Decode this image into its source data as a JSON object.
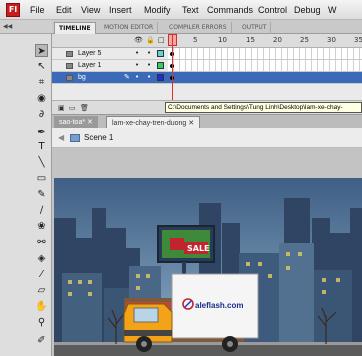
{
  "app": {
    "logo_text": "Fl"
  },
  "menu": [
    "File",
    "Edit",
    "View",
    "Insert",
    "Modify",
    "Text",
    "Commands",
    "Control",
    "Debug",
    "W"
  ],
  "panel_tabs": [
    "TIMELINE",
    "MOTION EDITOR",
    "COMPILER ERRORS",
    "OUTPUT"
  ],
  "timeline": {
    "frame_numbers": [
      "1",
      "5",
      "10",
      "15",
      "20",
      "25",
      "30",
      "35"
    ],
    "current_frame": 1,
    "layers": [
      {
        "name": "Layer 5",
        "color": "#5fd3d3",
        "selected": false
      },
      {
        "name": "Layer 1",
        "color": "#33cc66",
        "selected": false
      },
      {
        "name": "bg",
        "color": "#1a2fd8",
        "selected": true
      }
    ],
    "path_tooltip": "C:\\Documents and Settings\\Tung Linh\\Desktop\\lam-xe-chay-"
  },
  "document_tabs": [
    {
      "label": "sao-toa*",
      "active": false
    },
    {
      "label": "lam-xe-chay-tren-duong",
      "active": true
    }
  ],
  "editbar": {
    "scene": "Scene 1"
  },
  "stage": {
    "billboard_text": "SALE",
    "truck_sign_text": "aleflash.com"
  },
  "colors": {
    "sky_top": "#3f5e84",
    "sky_bottom": "#8eb0c8",
    "truck_cab": "#f2a317",
    "playhead": "#e0302c",
    "selected_layer": "#3a6ab8"
  }
}
